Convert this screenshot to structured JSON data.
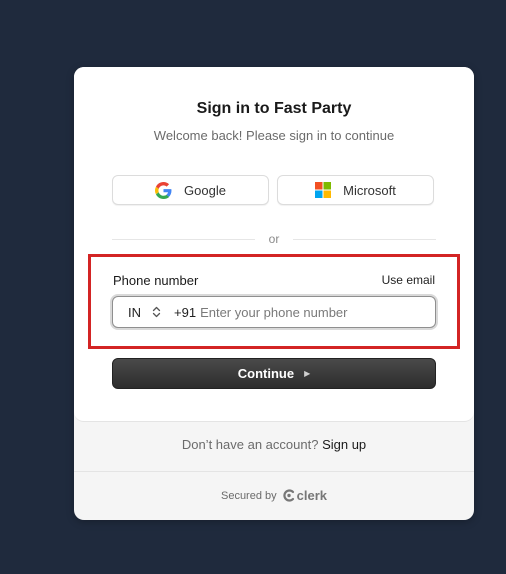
{
  "card": {
    "title": "Sign in to Fast Party",
    "subtitle": "Welcome back! Please sign in to continue"
  },
  "social": {
    "google_label": "Google",
    "google_icon": "google-icon",
    "microsoft_label": "Microsoft",
    "microsoft_icon": "microsoft-icon"
  },
  "divider_text": "or",
  "phone": {
    "label": "Phone number",
    "switch_label": "Use email",
    "country_code": "IN",
    "dial_code": "+91",
    "value": "",
    "placeholder": "Enter your phone number"
  },
  "continue_label": "Continue",
  "footer": {
    "prompt": "Don’t have an account?",
    "signup_label": "Sign up",
    "secured_by": "Secured by",
    "brand": "clerk"
  },
  "colors": {
    "background": "#1f2a3d",
    "highlight_border": "#d32424",
    "continue_button": "#333333"
  }
}
